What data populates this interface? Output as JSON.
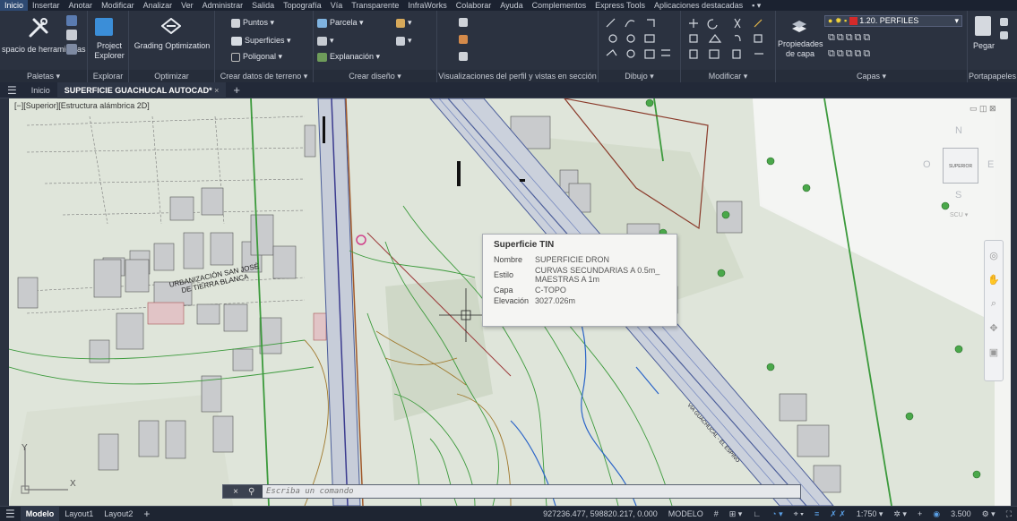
{
  "menu": {
    "tabs": [
      "Inicio",
      "Insertar",
      "Anotar",
      "Modificar",
      "Analizar",
      "Ver",
      "Administrar",
      "Salida",
      "Topografía",
      "Vía",
      "Transparente",
      "InfraWorks",
      "Colaborar",
      "Ayuda",
      "Complementos",
      "Express Tools",
      "Aplicaciones destacadas"
    ],
    "active": "Inicio"
  },
  "ribbon": {
    "paletas": {
      "title": "Paletas ▾",
      "workspace_label": "spacio de herramientas"
    },
    "explorar": {
      "title": "Explorar",
      "project_explorer": "Project Explorer"
    },
    "optimizar": {
      "title": "Optimizar",
      "grading": "Grading Optimization"
    },
    "terreno": {
      "title": "Crear datos de terreno ▾",
      "puntos": "Puntos ▾",
      "superficies": "Superficies ▾",
      "poligonal": "Poligonal ▾"
    },
    "diseno": {
      "title": "Crear diseño ▾",
      "parcela": "Parcela ▾",
      "explanacion": "Explanación ▾"
    },
    "perfil": {
      "title": "Visualizaciones del perfil y vistas en sección"
    },
    "dibujo": {
      "title": "Dibujo ▾"
    },
    "modificar": {
      "title": "Modificar ▾"
    },
    "capas": {
      "title": "Capas ▾",
      "propiedades": "Propiedades de capa",
      "current_layer": "1.20. PERFILES"
    },
    "portapapeles": {
      "title": "Portapapeles",
      "pegar": "Pegar"
    }
  },
  "filetabs": {
    "inicio": "Inicio",
    "current": "SUPERFICIE GUACHUCAL AUTOCAD*",
    "close": "×",
    "add": "+"
  },
  "viewport": {
    "label": "[−][Superior][Estructura alámbrica 2D]",
    "annotation1": "URBANIZACIÓN SAN JOSÉ",
    "annotation2": "DE TIERRA BLANCA",
    "road_label": "VÍA GUACHUCAL - EL ESPINO"
  },
  "viewcube": {
    "face": "SUPERIOR",
    "n": "N",
    "s": "S",
    "e": "E",
    "w": "O",
    "wcs": "SCU ▾"
  },
  "ucs": {
    "x": "X",
    "y": "Y"
  },
  "tooltip": {
    "title": "Superficie TIN",
    "rows": [
      {
        "k": "Nombre",
        "v": "SUPERFICIE DRON"
      },
      {
        "k": "Estilo",
        "v": "CURVAS SECUNDARIAS A 0.5m_ MAESTRAS A 1m"
      },
      {
        "k": "Capa",
        "v": "C-TOPO"
      },
      {
        "k": "Elevación",
        "v": "3027.026m"
      }
    ]
  },
  "command": {
    "placeholder": "Escriba un comando",
    "icon": "×"
  },
  "status": {
    "modelo": "Modelo",
    "layout1": "Layout1",
    "layout2": "Layout2",
    "add": "+",
    "coords": "927236.477, 598820.217, 0.000",
    "mode": "MODELO",
    "scale": "1:750 ▾",
    "value": "3.500"
  },
  "colors": {
    "ribbon_bg": "#2b3240",
    "canvas_bg": "#e9ece8",
    "contour_green": "#3c9a3c",
    "contour_brown": "#a0782c",
    "road_blue": "#5468a8"
  }
}
